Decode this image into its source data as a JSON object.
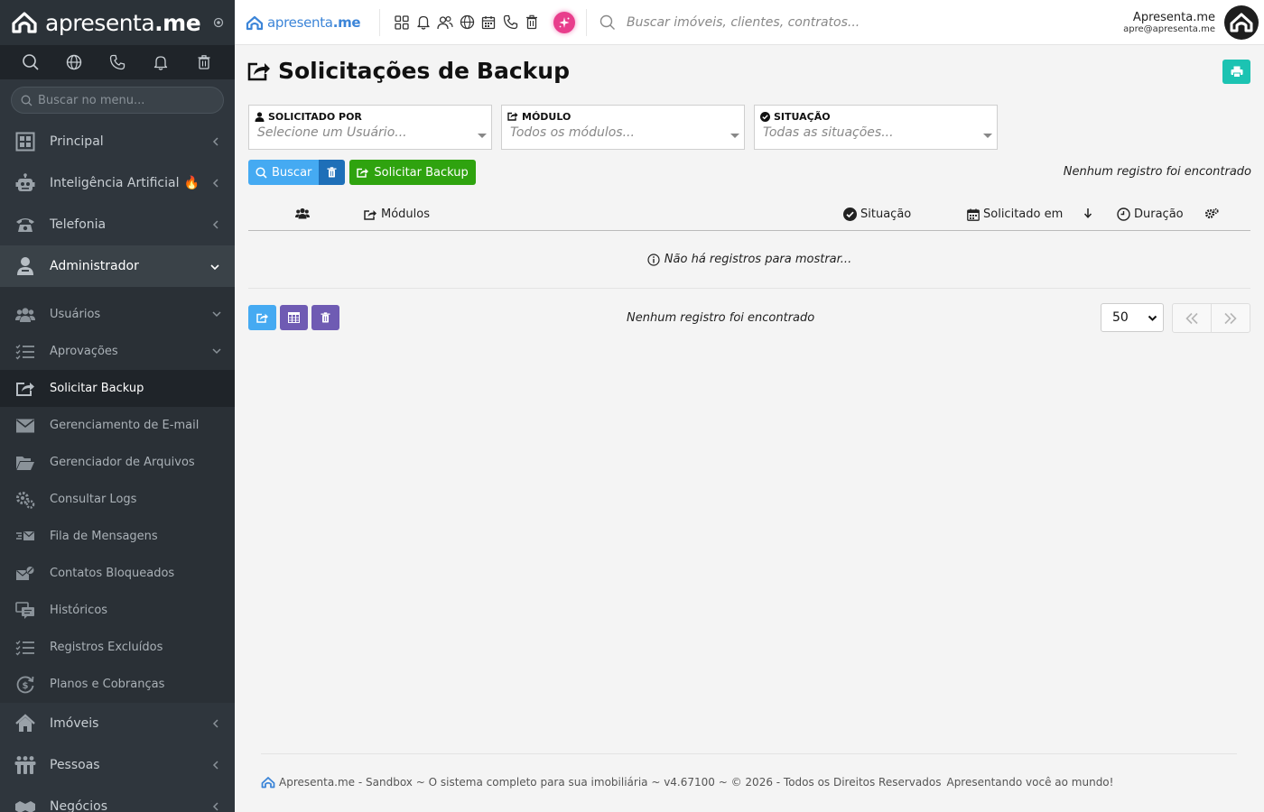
{
  "sidebar": {
    "brand": {
      "light": "apresenta",
      "bold": ".me"
    },
    "search_placeholder": "Buscar no menu...",
    "main_items": [
      {
        "label": "Principal"
      },
      {
        "label": "Inteligência Artificial",
        "emoji": "🔥"
      },
      {
        "label": "Telefonia"
      },
      {
        "label": "Administrador"
      }
    ],
    "admin_sub": [
      {
        "label": "Usuários"
      },
      {
        "label": "Aprovações"
      },
      {
        "label": "Solicitar Backup"
      },
      {
        "label": "Gerenciamento de E-mail"
      },
      {
        "label": "Gerenciador de Arquivos"
      },
      {
        "label": "Consultar Logs"
      },
      {
        "label": "Fila de Mensagens"
      },
      {
        "label": "Contatos Bloqueados"
      },
      {
        "label": "Históricos"
      },
      {
        "label": "Registros Excluídos"
      },
      {
        "label": "Planos e Cobranças"
      }
    ],
    "after_items": [
      {
        "label": "Imóveis"
      },
      {
        "label": "Pessoas"
      },
      {
        "label": "Negócios"
      }
    ]
  },
  "topbar": {
    "brand": {
      "light": "apresenta",
      "bold": ".me"
    },
    "search_placeholder": "Buscar imóveis, clientes, contratos...",
    "user_name": "Apresenta.me",
    "user_email": "apre@apresenta.me"
  },
  "page": {
    "title_light": "Solicitações de",
    "title_bold": "Backup"
  },
  "filters": [
    {
      "label": "SOLICITADO POR",
      "placeholder": "Selecione um Usuário..."
    },
    {
      "label": "MÓDULO",
      "placeholder": "Todos os módulos..."
    },
    {
      "label": "SITUAÇÃO",
      "placeholder": "Todas as situações..."
    }
  ],
  "buttons": {
    "search": "Buscar",
    "request_backup": "Solicitar Backup"
  },
  "messages": {
    "no_records": "Nenhum registro foi encontrado",
    "empty_table": "Não há registros para mostrar..."
  },
  "table": {
    "columns": {
      "modules": "Módulos",
      "status": "Situação",
      "requested_at": "Solicitado em",
      "duration": "Duração"
    }
  },
  "pagination": {
    "per_page": "50"
  },
  "footer": {
    "text": "Apresenta.me - Sandbox ~ O sistema completo para sua imobiliária ~ v4.67100 ~ © 2026 - Todos os Direitos Reservados",
    "slogan": "Apresentando você ao mundo!"
  },
  "colors": {
    "sidebar_bg": "#2f363d",
    "accent_blue": "#45aaf2",
    "accent_green": "#2fa30f",
    "accent_purple": "#6f5bb3",
    "accent_teal": "#1cc3b2",
    "ai_pink": "#e83e8c"
  }
}
